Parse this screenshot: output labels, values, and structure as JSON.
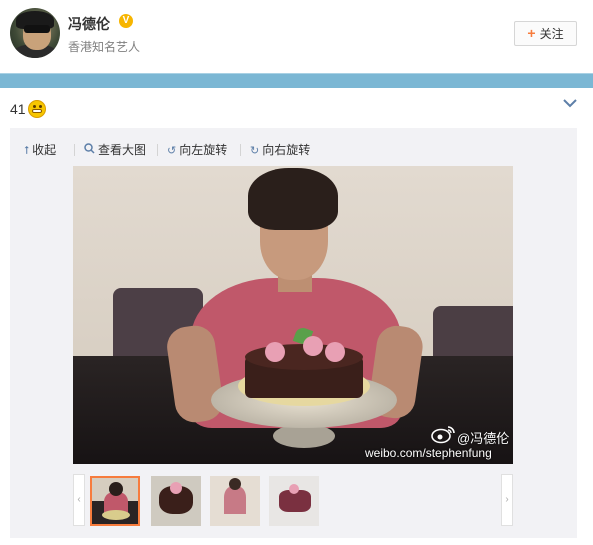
{
  "header": {
    "username": "冯德伦",
    "verified_mark": "V",
    "subtitle": "香港知名艺人",
    "follow_plus": "+",
    "follow_label": "关注"
  },
  "post": {
    "text": "41",
    "emoji": "grinning-emoji"
  },
  "media_toolbar": {
    "items": [
      {
        "icon": "collapse-up-arrow-icon",
        "label": "收起"
      },
      {
        "icon": "magnifier-icon",
        "label": "查看大图"
      },
      {
        "icon": "rotate-left-icon",
        "label": "向左旋转"
      },
      {
        "icon": "rotate-right-icon",
        "label": "向右旋转"
      }
    ]
  },
  "photo": {
    "watermark_handle": "@冯德伦",
    "watermark_url": "weibo.com/stephenfung"
  },
  "thumbnails": {
    "prev_glyph": "‹",
    "next_glyph": "›",
    "selected_index": 0,
    "count": 4
  },
  "colors": {
    "accent_orange": "#f77c3d",
    "blue_bar": "#7bb7d4",
    "link_blue": "#5d7fa8",
    "verified_gold": "#f7b500"
  }
}
